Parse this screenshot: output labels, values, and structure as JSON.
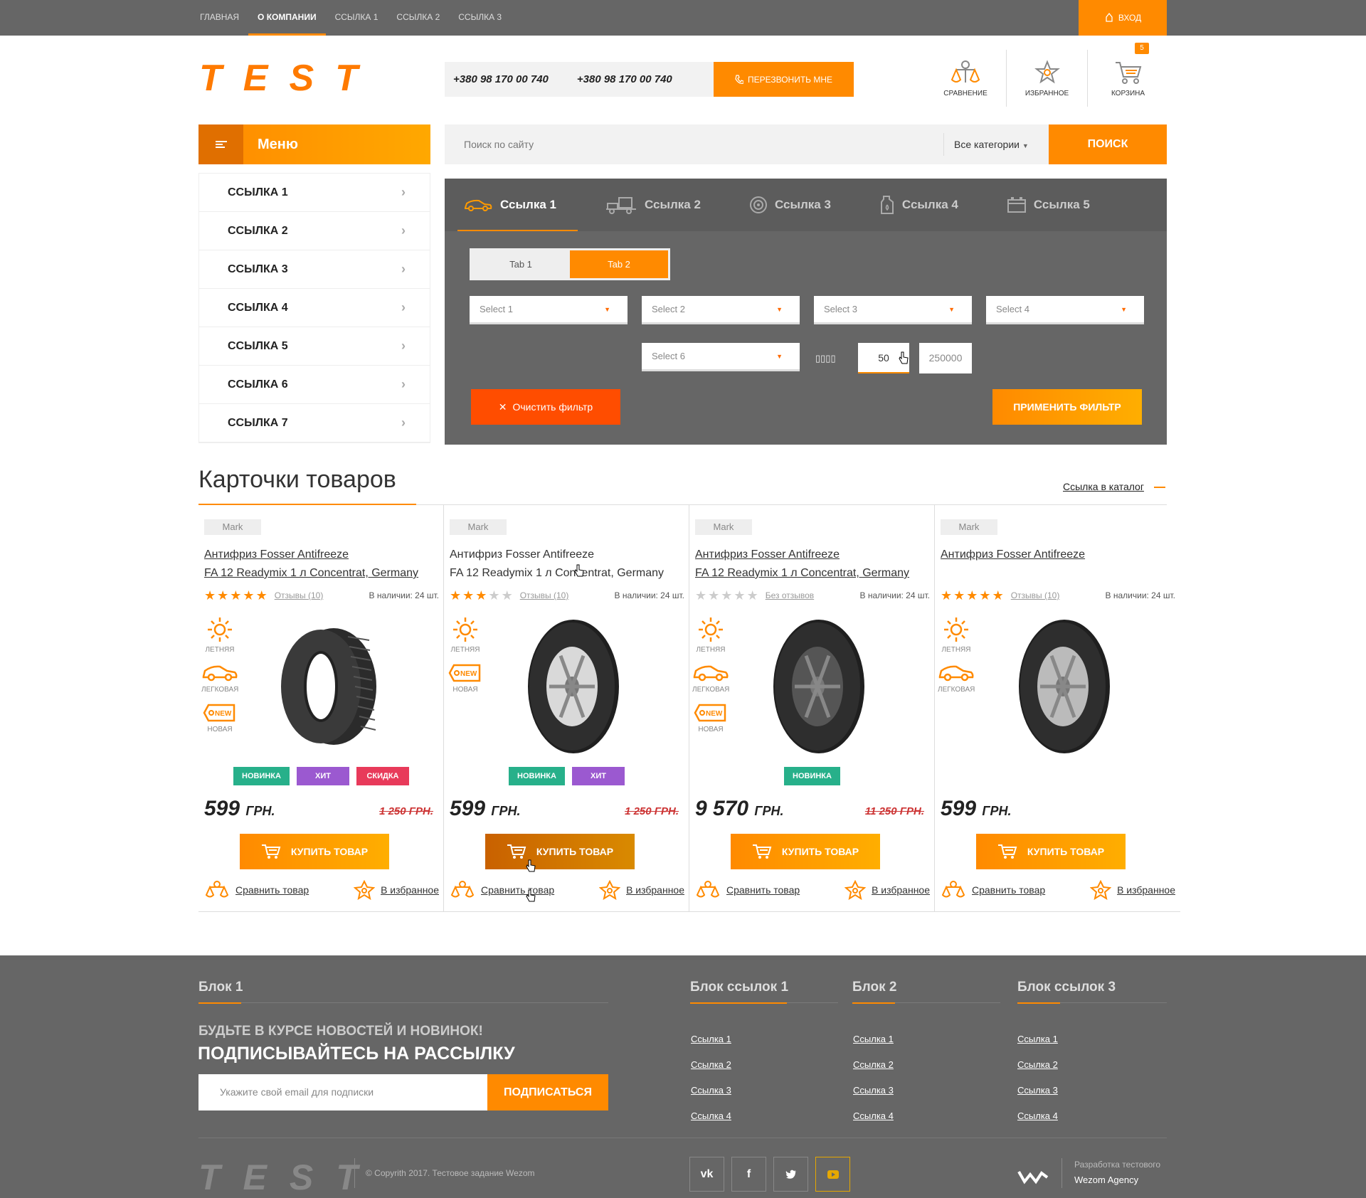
{
  "topnav": {
    "items": [
      "ГЛАВНАЯ",
      "О КОМПАНИИ",
      "ССЫЛКА 1",
      "ССЫЛКА 2",
      "ССЫЛКА 3"
    ],
    "login_label": "ВХОД"
  },
  "header": {
    "logo": "TEST",
    "phone1": "+380 98 170 00 740",
    "phone2": "+380 98 170 00 740",
    "callback_label": "ПЕРЕЗВОНИТЬ МНЕ",
    "compare_label": "СРАВНЕНИЕ",
    "favorites_label": "ИЗБРАННОЕ",
    "cart_label": "КОРЗИНА",
    "cart_count": "5"
  },
  "menu": {
    "title": "Меню",
    "items": [
      "ССЫЛКА 1",
      "ССЫЛКА 2",
      "ССЫЛКА 3",
      "ССЫЛКА 4",
      "ССЫЛКА 5",
      "ССЫЛКА 6",
      "ССЫЛКА 7"
    ]
  },
  "search": {
    "placeholder": "Поиск по сайту",
    "category": "Все категории",
    "button": "ПОИСК"
  },
  "filter": {
    "tabs": [
      "Ссылка 1",
      "Ссылка 2",
      "Ссылка 3",
      "Ссылка 4",
      "Ссылка 5"
    ],
    "subtabs": [
      "Tab 1",
      "Tab 2"
    ],
    "selects": [
      "Select 1",
      "Select 2",
      "Select 3",
      "Select 4",
      "Select 6"
    ],
    "range_label": "▯▯▯▯",
    "range_from": "50",
    "range_to": "250000",
    "clear_label": "Очистить фильтр",
    "apply_label": "ПРИМЕНИТЬ ФИЛЬТР"
  },
  "products_section": {
    "title": "Карточки товаров",
    "catalog_link": "Ссылка в каталог"
  },
  "products": [
    {
      "mark": "Mark",
      "title1": "Антифриз Fosser Antifreeze ",
      "title2": "FA 12 Readymix 1 л Concentrat, Germany",
      "rating": 5,
      "reviews": "Отзывы (10)",
      "stock": "В наличии: 24 шт.",
      "attrs": [
        "ЛЕТНЯЯ",
        "ЛЕГКОВАЯ",
        "НОВАЯ"
      ],
      "badges": [
        "НОВИНКА",
        "ХИТ",
        "СКИДКА"
      ],
      "price": "599",
      "currency": "ГРН.",
      "old_price": "1 250 ГРН.",
      "buy": "КУПИТЬ ТОВАР",
      "compare": "Сравнить товар",
      "favorite": "В избранное"
    },
    {
      "mark": "Mark",
      "title1": "Антифриз Fosser Antifreeze",
      "title2": "FA 12 Readymix 1 л Concentrat, Germany",
      "rating": 3,
      "reviews": "Отзывы (10)",
      "stock": "В наличии: 24 шт.",
      "attrs": [
        "ЛЕТНЯЯ",
        "НОВАЯ"
      ],
      "badges": [
        "НОВИНКА",
        "ХИТ"
      ],
      "price": "599",
      "currency": "ГРН.",
      "old_price": "1 250 ГРН.",
      "buy": "КУПИТЬ ТОВАР",
      "compare": "Сравнить товар",
      "favorite": "В избранное"
    },
    {
      "mark": "Mark",
      "title1": "Антифриз Fosser Antifreeze ",
      "title2": "FA 12 Readymix 1 л Concentrat, Germany",
      "rating": 0,
      "reviews": "Без отзывов",
      "stock": "В наличии: 24 шт.",
      "attrs": [
        "ЛЕТНЯЯ",
        "ЛЕГКОВАЯ",
        "НОВАЯ"
      ],
      "badges": [
        "НОВИНКА"
      ],
      "price": "9 570",
      "currency": "ГРН.",
      "old_price": "11 250 ГРН.",
      "buy": "КУПИТЬ ТОВАР",
      "compare": "Сравнить товар",
      "favorite": "В избранное"
    },
    {
      "mark": "Mark",
      "title1": "Антифриз Fosser Antifreeze ",
      "title2": "",
      "rating": 5,
      "reviews": "Отзывы (10)",
      "stock": "В наличии: 24 шт.",
      "attrs": [
        "ЛЕТНЯЯ",
        "ЛЕГКОВАЯ"
      ],
      "badges": [],
      "price": "599",
      "currency": "ГРН.",
      "old_price": "",
      "buy": "КУПИТЬ ТОВАР",
      "compare": "Сравнить товар",
      "favorite": "В избранное"
    }
  ],
  "footer": {
    "block1_title": "Блок 1",
    "links1_title": "Блок ссылок 1",
    "block2_title": "Блок 2",
    "links3_title": "Блок ссылок 3",
    "newsletter_line1": "БУДЬТЕ В КУРСЕ НОВОСТЕЙ И НОВИНОК!",
    "newsletter_line2": "ПОДПИСЫВАЙТЕСЬ НА РАССЫЛКУ",
    "email_placeholder": "Укажите свой email для подписки",
    "subscribe_label": "ПОДПИСАТЬСЯ",
    "links": [
      "Ссылка 1",
      "Ссылка 2",
      "Ссылка 3",
      "Ссылка 4"
    ],
    "logo": "TEST",
    "copyright": "© Copyrith 2017. Тестовое задание Wezom",
    "social": [
      "vk",
      "f",
      "twitter",
      "youtube"
    ],
    "dev_line1": "Разработка тестового",
    "dev_line2": "Wezom Agency"
  },
  "colors": {
    "accent": "#ff8a00",
    "dark_gray": "#666666",
    "new": "#27b08a",
    "hit": "#9b59d0",
    "sale": "#e83a5a"
  }
}
